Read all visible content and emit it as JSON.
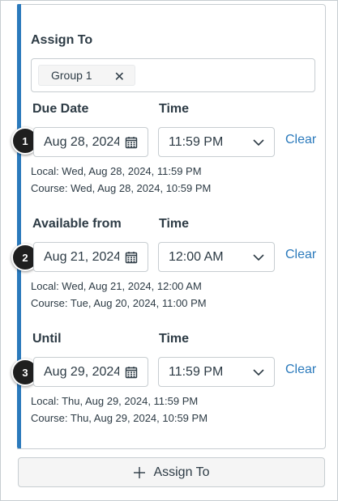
{
  "assign_to": {
    "label": "Assign To",
    "tag_label": "Group 1"
  },
  "sections": [
    {
      "badge": "1",
      "date_label": "Due Date",
      "time_label": "Time",
      "date_value": "Aug 28, 2024",
      "time_value": "11:59 PM",
      "clear_label": "Clear",
      "local_line": "Local: Wed, Aug 28, 2024, 11:59 PM",
      "course_line": "Course: Wed, Aug 28, 2024, 10:59 PM"
    },
    {
      "badge": "2",
      "date_label": "Available from",
      "time_label": "Time",
      "date_value": "Aug 21, 2024",
      "time_value": "12:00 AM",
      "clear_label": "Clear",
      "local_line": "Local: Wed, Aug 21, 2024, 12:00 AM",
      "course_line": "Course: Tue, Aug 20, 2024, 11:00 PM"
    },
    {
      "badge": "3",
      "date_label": "Until",
      "time_label": "Time",
      "date_value": "Aug 29, 2024",
      "time_value": "11:59 PM",
      "clear_label": "Clear",
      "local_line": "Local: Thu, Aug 29, 2024, 11:59 PM",
      "course_line": "Course: Thu, Aug 29, 2024, 10:59 PM"
    }
  ],
  "add_button": {
    "label": "Assign To"
  },
  "icons": {
    "tag_remove": "close-icon",
    "date_picker": "calendar-icon",
    "time_dropdown": "chevron-down-icon",
    "add": "plus-icon"
  },
  "colors": {
    "accent": "#2b7abc",
    "link": "#2b7abc",
    "badge": "#1f1f1f",
    "border": "#c7cdd1"
  }
}
